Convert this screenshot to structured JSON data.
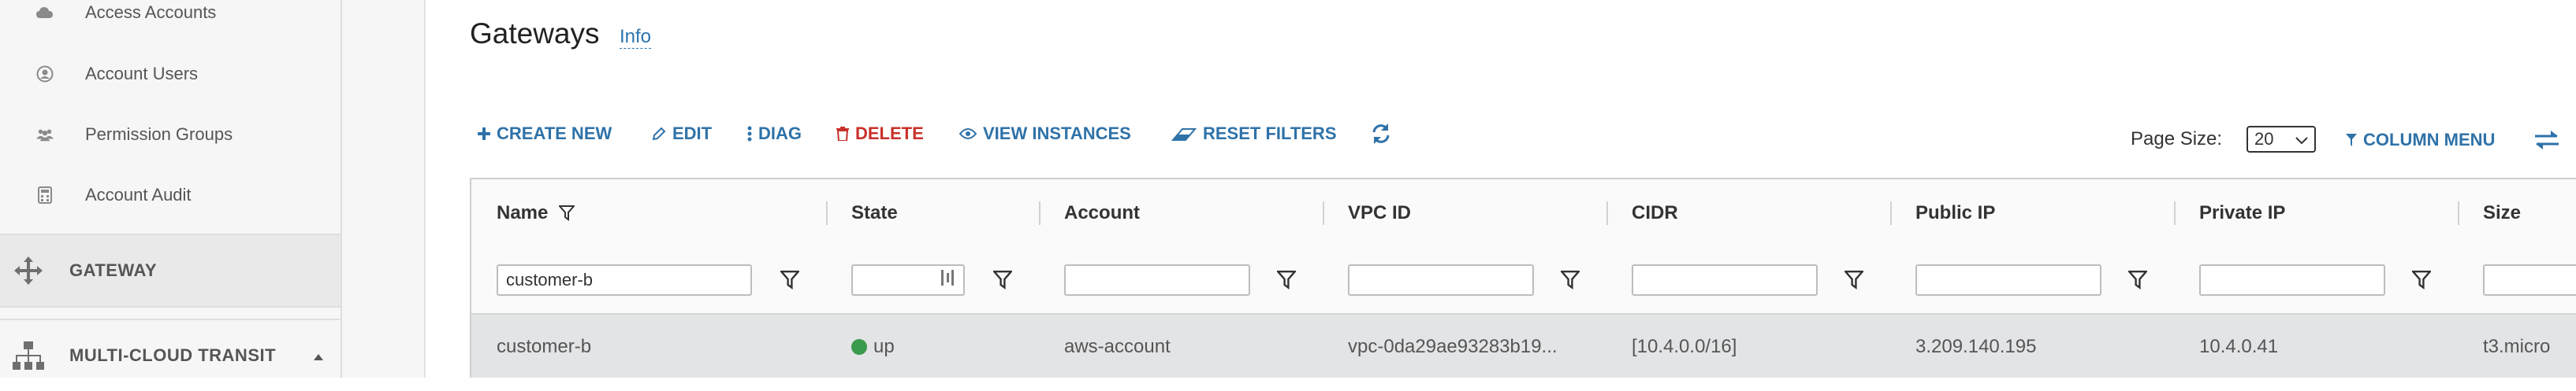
{
  "sidebar": {
    "items": [
      {
        "label": "Access Accounts",
        "icon": "cloud-icon"
      },
      {
        "label": "Account Users",
        "icon": "user-circle-icon"
      },
      {
        "label": "Permission Groups",
        "icon": "users-icon"
      },
      {
        "label": "Account Audit",
        "icon": "calculator-icon"
      }
    ],
    "sections": [
      {
        "label": "GATEWAY",
        "icon": "move-arrows-icon"
      },
      {
        "label": "MULTI-CLOUD TRANSIT",
        "icon": "network-tree-icon"
      }
    ]
  },
  "header": {
    "title": "Gateways",
    "info_label": "Info"
  },
  "toolbar": {
    "create_label": "CREATE NEW",
    "edit_label": "EDIT",
    "diag_label": "DIAG",
    "delete_label": "DELETE",
    "view_instances_label": "VIEW INSTANCES",
    "reset_filters_label": "RESET FILTERS",
    "page_size_label": "Page Size:",
    "page_size_value": "20",
    "column_menu_label": "COLUMN MENU"
  },
  "grid": {
    "columns": [
      "Name",
      "State",
      "Account",
      "VPC ID",
      "CIDR",
      "Public IP",
      "Private IP",
      "Size"
    ],
    "filters": {
      "name": "customer-b"
    },
    "rows": [
      {
        "name": "customer-b",
        "state": "up",
        "account": "aws-account",
        "vpc_id": "vpc-0da29ae93283b19...",
        "cidr": "[10.4.0.0/16]",
        "public_ip": "3.209.140.195",
        "private_ip": "10.4.0.41",
        "size": "t3.micro"
      }
    ]
  },
  "colors": {
    "accent": "#2f72a8",
    "danger": "#c9302c",
    "status_up": "#3a9a4d",
    "sidebar_bg": "#f6f6f6",
    "row_selected_bg": "#e3e4e6"
  }
}
